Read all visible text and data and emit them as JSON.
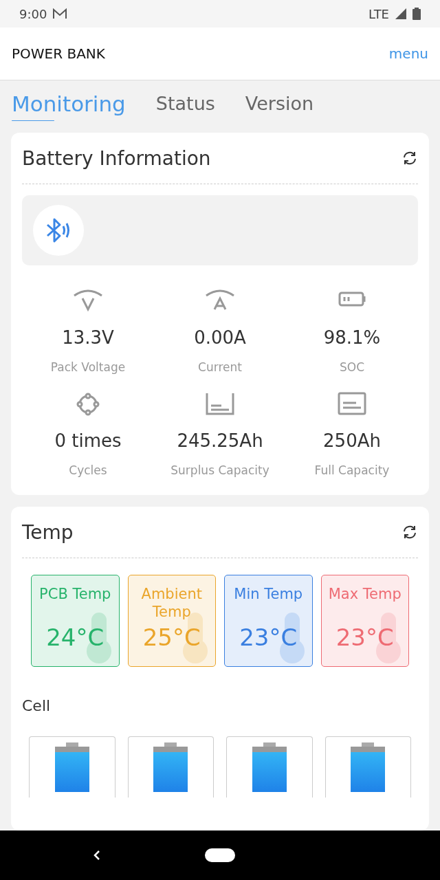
{
  "status_bar": {
    "time": "9:00",
    "network": "LTE"
  },
  "header": {
    "title": "POWER BANK",
    "menu": "menu"
  },
  "tabs": [
    {
      "label": "Monitoring",
      "selected": true
    },
    {
      "label": "Status",
      "selected": false
    },
    {
      "label": "Version",
      "selected": false
    }
  ],
  "battery_card": {
    "title": "Battery Information",
    "metrics": [
      {
        "kind": "voltage",
        "value": "13.3V",
        "label": "Pack Voltage"
      },
      {
        "kind": "current",
        "value": "0.00A",
        "label": "Current"
      },
      {
        "kind": "battery",
        "value": "98.1%",
        "label": "SOC"
      },
      {
        "kind": "cycle",
        "value": "0 times",
        "label": "Cycles"
      },
      {
        "kind": "tray",
        "value": "245.25Ah",
        "label": "Surplus Capacity"
      },
      {
        "kind": "box",
        "value": "250Ah",
        "label": "Full Capacity"
      }
    ]
  },
  "temp_card": {
    "title": "Temp",
    "temps": [
      {
        "label": "PCB Temp",
        "value": "24°C",
        "color": "#27b36b"
      },
      {
        "label": "Ambient Temp",
        "value": "25°C",
        "color": "#eaa52a"
      },
      {
        "label": "Min Temp",
        "value": "23°C",
        "color": "#3a7fe0"
      },
      {
        "label": "Max Temp",
        "value": "23°C",
        "color": "#ee6b73"
      }
    ],
    "cell_title": "Cell",
    "cells": [
      {
        "kind": "battery"
      },
      {
        "kind": "battery"
      },
      {
        "kind": "battery"
      },
      {
        "kind": "battery"
      }
    ]
  }
}
